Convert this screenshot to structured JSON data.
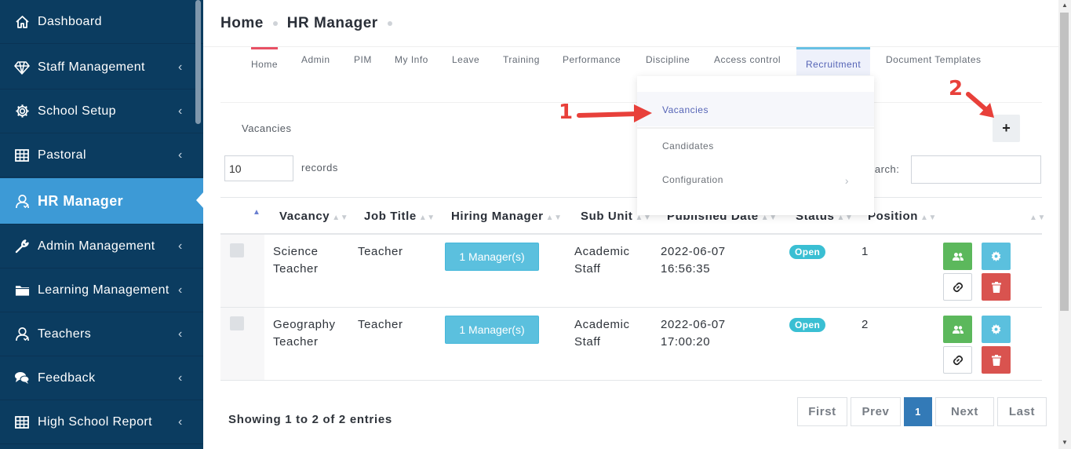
{
  "sidebar": {
    "items": [
      {
        "label": "Dashboard",
        "icon": "home-icon",
        "chevron": false
      },
      {
        "label": "Staff Management",
        "icon": "diamond-icon",
        "chevron": true
      },
      {
        "label": "School Setup",
        "icon": "gear-icon",
        "chevron": true
      },
      {
        "label": "Pastoral",
        "icon": "grid-icon",
        "chevron": true
      },
      {
        "label": "HR Manager",
        "icon": "user-icon",
        "chevron": false,
        "active": true
      },
      {
        "label": "Admin Management",
        "icon": "wrench-icon",
        "chevron": true
      },
      {
        "label": "Learning Management",
        "icon": "folder-icon",
        "chevron": true
      },
      {
        "label": "Teachers",
        "icon": "user-icon",
        "chevron": true
      },
      {
        "label": "Feedback",
        "icon": "chat-icon",
        "chevron": true
      },
      {
        "label": "High School Report",
        "icon": "grid-icon",
        "chevron": true
      }
    ],
    "chevron_glyph": "‹"
  },
  "breadcrumb": {
    "home": "Home",
    "current": "HR Manager"
  },
  "tabs": [
    "Home",
    "Admin",
    "PIM",
    "My Info",
    "Leave",
    "Training",
    "Performance",
    "Discipline",
    "Access control",
    "Recruitment",
    "Document Templates"
  ],
  "active_tab": "Recruitment",
  "dropdown": {
    "items": [
      "Vacancies",
      "Candidates",
      "Configuration"
    ],
    "chevron": "›"
  },
  "card": {
    "title": "Vacancies",
    "add_label": "+",
    "page_length": "10",
    "length_label": "records",
    "search_label": "Search:"
  },
  "table": {
    "columns": [
      "Vacancy",
      "Job Title",
      "Hiring Manager",
      "Sub Unit",
      "Published Date",
      "Status",
      "Position"
    ],
    "sort_glyph": "▲▼",
    "sort_active": "▲",
    "rows": [
      {
        "vacancy": "Science Teacher",
        "job_title": "Teacher",
        "manager_btn": "1 Manager(s)",
        "sub_unit": "Academic Staff",
        "published": "2022-06-07 16:56:35",
        "status": "Open",
        "position": "1"
      },
      {
        "vacancy": "Geography Teacher",
        "job_title": "Teacher",
        "manager_btn": "1 Manager(s)",
        "sub_unit": "Academic Staff",
        "published": "2022-06-07 17:00:20",
        "status": "Open",
        "position": "2"
      }
    ]
  },
  "footer": {
    "info": "Showing 1 to 2 of 2 entries",
    "pager": [
      "First",
      "Prev",
      "1",
      "Next",
      "Last"
    ]
  },
  "annotations": {
    "one": "1",
    "two": "2"
  },
  "colors": {
    "sidebar_bg": "#0b3c60",
    "sidebar_active": "#3d9ad6",
    "accent_red": "#e85064",
    "info_blue": "#5bc0de",
    "success_green": "#5cb85c",
    "danger_red": "#d9534f",
    "annotation_red": "#e8403a",
    "pager_current": "#337ab7"
  }
}
